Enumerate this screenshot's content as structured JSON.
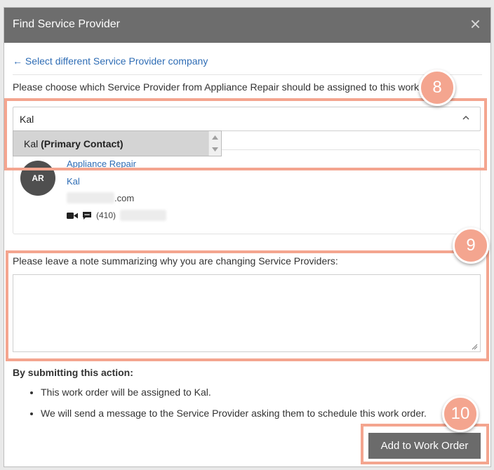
{
  "modal": {
    "title": "Find Service Provider",
    "close_symbol": "×"
  },
  "link_back": {
    "arrow": "←",
    "label": "Select different Service Provider company"
  },
  "prompt": "Please choose which Service Provider from Appliance Repair should be assigned to this work order:",
  "select": {
    "value": "Kal",
    "dropdown_option": {
      "name": "Kal",
      "tag": "(Primary Contact)"
    }
  },
  "provider_card": {
    "avatar_initials": "AR",
    "company": "Appliance Repair",
    "contact": "Kal",
    "email_suffix": ".com",
    "phone_prefix": "(410)"
  },
  "note": {
    "label": "Please leave a note summarizing why you are changing Service Providers:",
    "value": ""
  },
  "submit": {
    "heading": "By submitting this action:",
    "bullets": [
      "This work order will be assigned to Kal.",
      "We will send a message to the Service Provider asking them to schedule this work order."
    ],
    "button_label": "Add to Work Order"
  },
  "annotations": {
    "step_8": "8",
    "step_9": "9",
    "step_10": "10",
    "color": "#f4a58f"
  },
  "colors": {
    "header_bg": "#6d6d6d",
    "link": "#2f6db5",
    "button_bg": "#6b6b6b"
  }
}
